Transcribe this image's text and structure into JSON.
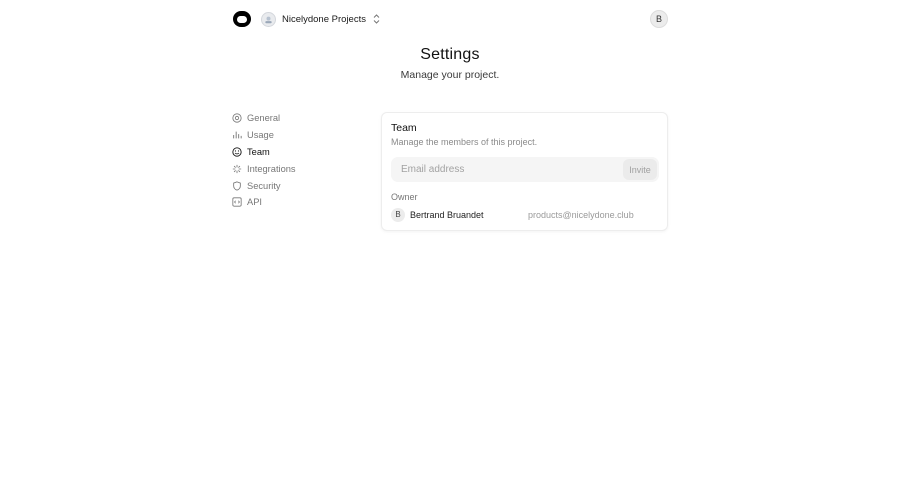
{
  "topbar": {
    "project_name": "Nicelydone Projects",
    "user_initial": "B"
  },
  "header": {
    "title": "Settings",
    "subtitle": "Manage your project."
  },
  "sidebar": {
    "items": [
      {
        "label": "General",
        "icon": "gear-icon",
        "active": false
      },
      {
        "label": "Usage",
        "icon": "usage-icon",
        "active": false
      },
      {
        "label": "Team",
        "icon": "smiley-icon",
        "active": true
      },
      {
        "label": "Integrations",
        "icon": "integrations-icon",
        "active": false
      },
      {
        "label": "Security",
        "icon": "shield-icon",
        "active": false
      },
      {
        "label": "API",
        "icon": "code-icon",
        "active": false
      }
    ]
  },
  "team": {
    "title": "Team",
    "subtitle": "Manage the members of this project.",
    "email_placeholder": "Email address",
    "email_value": "",
    "invite_label": "Invite",
    "owner_label": "Owner",
    "members": [
      {
        "initial": "B",
        "name": "Bertrand Bruandet",
        "email": "products@nicelydone.club"
      }
    ]
  }
}
